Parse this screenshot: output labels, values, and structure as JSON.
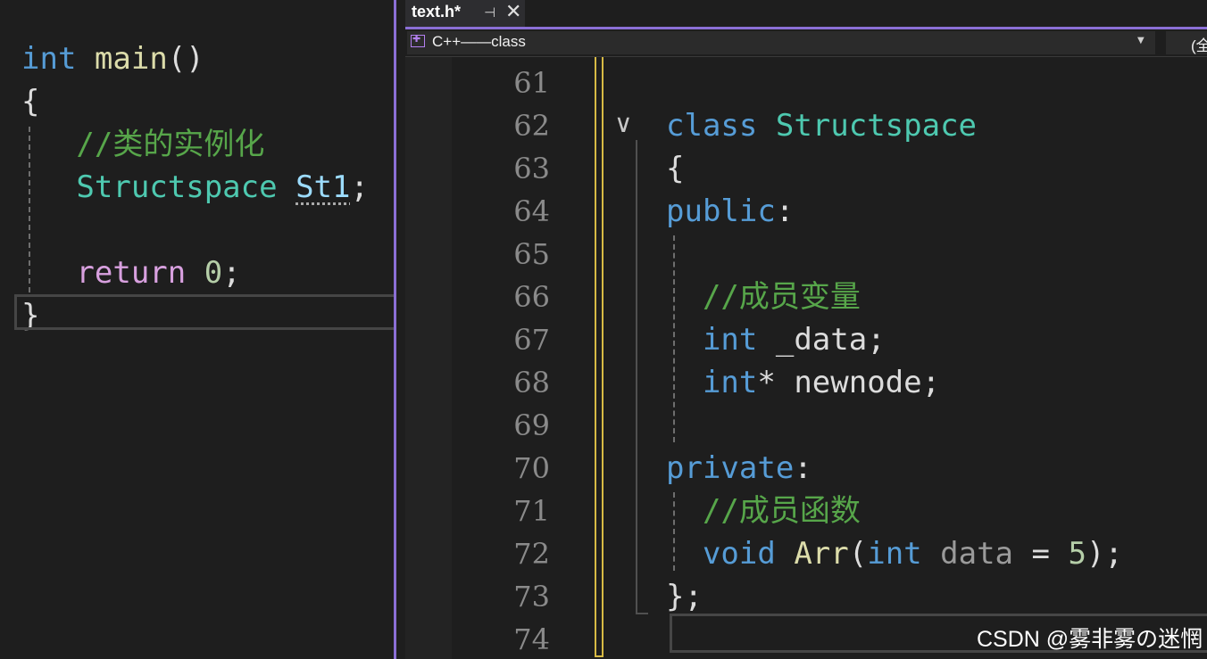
{
  "left_editor": {
    "lines": [
      {
        "tokens": [
          {
            "t": "int",
            "c": "kw"
          },
          {
            "t": " ",
            "c": "pl"
          },
          {
            "t": "main",
            "c": "fn"
          },
          {
            "t": "()",
            "c": "pl"
          }
        ]
      },
      {
        "tokens": [
          {
            "t": "{",
            "c": "pl"
          }
        ]
      },
      {
        "tokens": [
          {
            "t": "   ",
            "c": "pl"
          },
          {
            "t": "//类的实例化",
            "c": "cm"
          }
        ]
      },
      {
        "tokens": [
          {
            "t": "   ",
            "c": "pl"
          },
          {
            "t": "Structspace",
            "c": "ty"
          },
          {
            "t": " ",
            "c": "pl"
          },
          {
            "t": "St1",
            "c": "var squig"
          },
          {
            "t": ";",
            "c": "pl"
          }
        ]
      },
      {
        "tokens": []
      },
      {
        "tokens": [
          {
            "t": "   ",
            "c": "pl"
          },
          {
            "t": "return",
            "c": "ctl"
          },
          {
            "t": " ",
            "c": "pl"
          },
          {
            "t": "0",
            "c": "num"
          },
          {
            "t": ";",
            "c": "pl"
          }
        ]
      },
      {
        "tokens": [
          {
            "t": "}",
            "c": "pl"
          }
        ]
      }
    ]
  },
  "tab": {
    "title": "text.h*",
    "pin_icon": "pin-icon",
    "close_icon": "close-icon"
  },
  "navbar": {
    "scope": "C++——class",
    "member": "(全局"
  },
  "right_editor": {
    "lines": [
      {
        "num": "61",
        "tokens": []
      },
      {
        "num": "62",
        "tokens": [
          {
            "t": "class",
            "c": "kw"
          },
          {
            "t": " ",
            "c": "pl"
          },
          {
            "t": "Structspace",
            "c": "ty"
          }
        ]
      },
      {
        "num": "63",
        "tokens": [
          {
            "t": "{",
            "c": "pl"
          }
        ]
      },
      {
        "num": "64",
        "tokens": [
          {
            "t": "public",
            "c": "kw"
          },
          {
            "t": ":",
            "c": "pl"
          }
        ]
      },
      {
        "num": "65",
        "tokens": []
      },
      {
        "num": "66",
        "tokens": [
          {
            "t": "  ",
            "c": "pl"
          },
          {
            "t": "//成员变量",
            "c": "cm"
          }
        ]
      },
      {
        "num": "67",
        "tokens": [
          {
            "t": "  ",
            "c": "pl"
          },
          {
            "t": "int",
            "c": "kw"
          },
          {
            "t": " _data;",
            "c": "pl"
          }
        ]
      },
      {
        "num": "68",
        "tokens": [
          {
            "t": "  ",
            "c": "pl"
          },
          {
            "t": "int",
            "c": "kw"
          },
          {
            "t": "* newnode;",
            "c": "pl"
          }
        ]
      },
      {
        "num": "69",
        "tokens": []
      },
      {
        "num": "70",
        "tokens": [
          {
            "t": "private",
            "c": "kw"
          },
          {
            "t": ":",
            "c": "pl"
          }
        ]
      },
      {
        "num": "71",
        "tokens": [
          {
            "t": "  ",
            "c": "pl"
          },
          {
            "t": "//成员函数",
            "c": "cm"
          }
        ]
      },
      {
        "num": "72",
        "tokens": [
          {
            "t": "  ",
            "c": "pl"
          },
          {
            "t": "void",
            "c": "kw"
          },
          {
            "t": " ",
            "c": "pl"
          },
          {
            "t": "Arr",
            "c": "fn"
          },
          {
            "t": "(",
            "c": "pl"
          },
          {
            "t": "int",
            "c": "kw"
          },
          {
            "t": " ",
            "c": "pl"
          },
          {
            "t": "data",
            "c": "prm"
          },
          {
            "t": " = ",
            "c": "pl"
          },
          {
            "t": "5",
            "c": "num"
          },
          {
            "t": ");",
            "c": "pl"
          }
        ]
      },
      {
        "num": "73",
        "tokens": [
          {
            "t": "};",
            "c": "pl"
          }
        ]
      },
      {
        "num": "74",
        "tokens": []
      }
    ]
  },
  "watermark": "CSDN @雾非雾の迷惘",
  "colors": {
    "accent": "#8b6fd6",
    "change_bar": "#d7ba44",
    "keyword": "#569cd6",
    "type": "#4ec9b0",
    "comment": "#57a64a"
  }
}
